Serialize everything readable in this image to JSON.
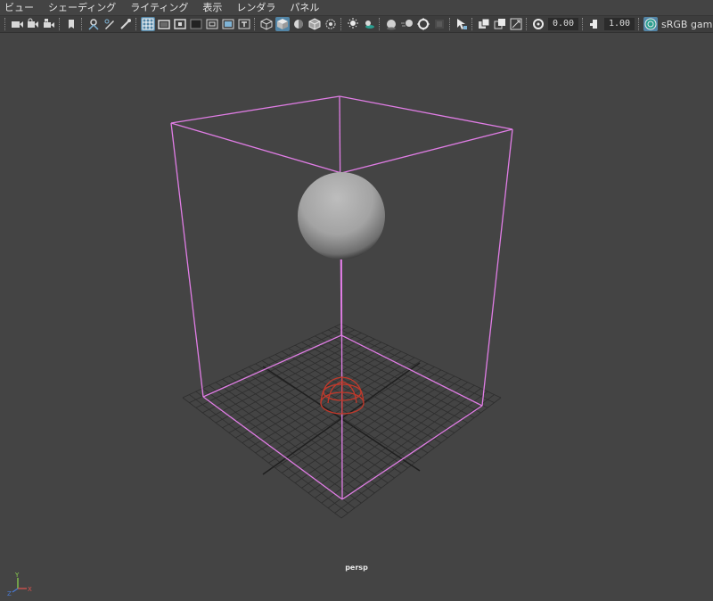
{
  "menu": {
    "items": [
      "ビュー",
      "シェーディング",
      "ライティング",
      "表示",
      "レンダラ",
      "パネル"
    ]
  },
  "toolbar": {
    "icons": [
      "select-camera-icon",
      "camera-attributes-icon",
      "camera-bookmark-icon",
      "image-plane-icon",
      "2d-pan-zoom-icon",
      "grease-pencil-icon",
      "grid-icon",
      "film-gate-icon",
      "resolution-gate-icon",
      "gate-mask-icon",
      "field-chart-icon",
      "safe-action-icon",
      "safe-title-icon",
      "wireframe-icon",
      "smooth-shade-all-icon",
      "use-default-material-icon",
      "wireframe-on-shaded-icon",
      "xray-icon",
      "use-all-lights-icon",
      "shadows-icon",
      "screen-space-ambient-occlusion-icon",
      "motion-blur-icon",
      "multisample-anti-aliasing-icon",
      "depth-of-field-icon",
      "isolate-select-icon",
      "xray-joints-icon",
      "xray-active-components-icon",
      "exposure-icon",
      "gamma-icon",
      "color-management-icon"
    ],
    "exposure_value": "0.00",
    "gamma_value": "1.00",
    "color_space": "sRGB gamma"
  },
  "viewport": {
    "camera_label": "persp",
    "background_color": "#444444",
    "selection_color": "#e07de5",
    "grid_color": "#2e2e2e",
    "light_color": "#c0392b",
    "sphere_color": "#a6a6a6"
  },
  "axis_indicator": {
    "y_label": "Y",
    "z_label": "Z",
    "x_label": "X"
  }
}
